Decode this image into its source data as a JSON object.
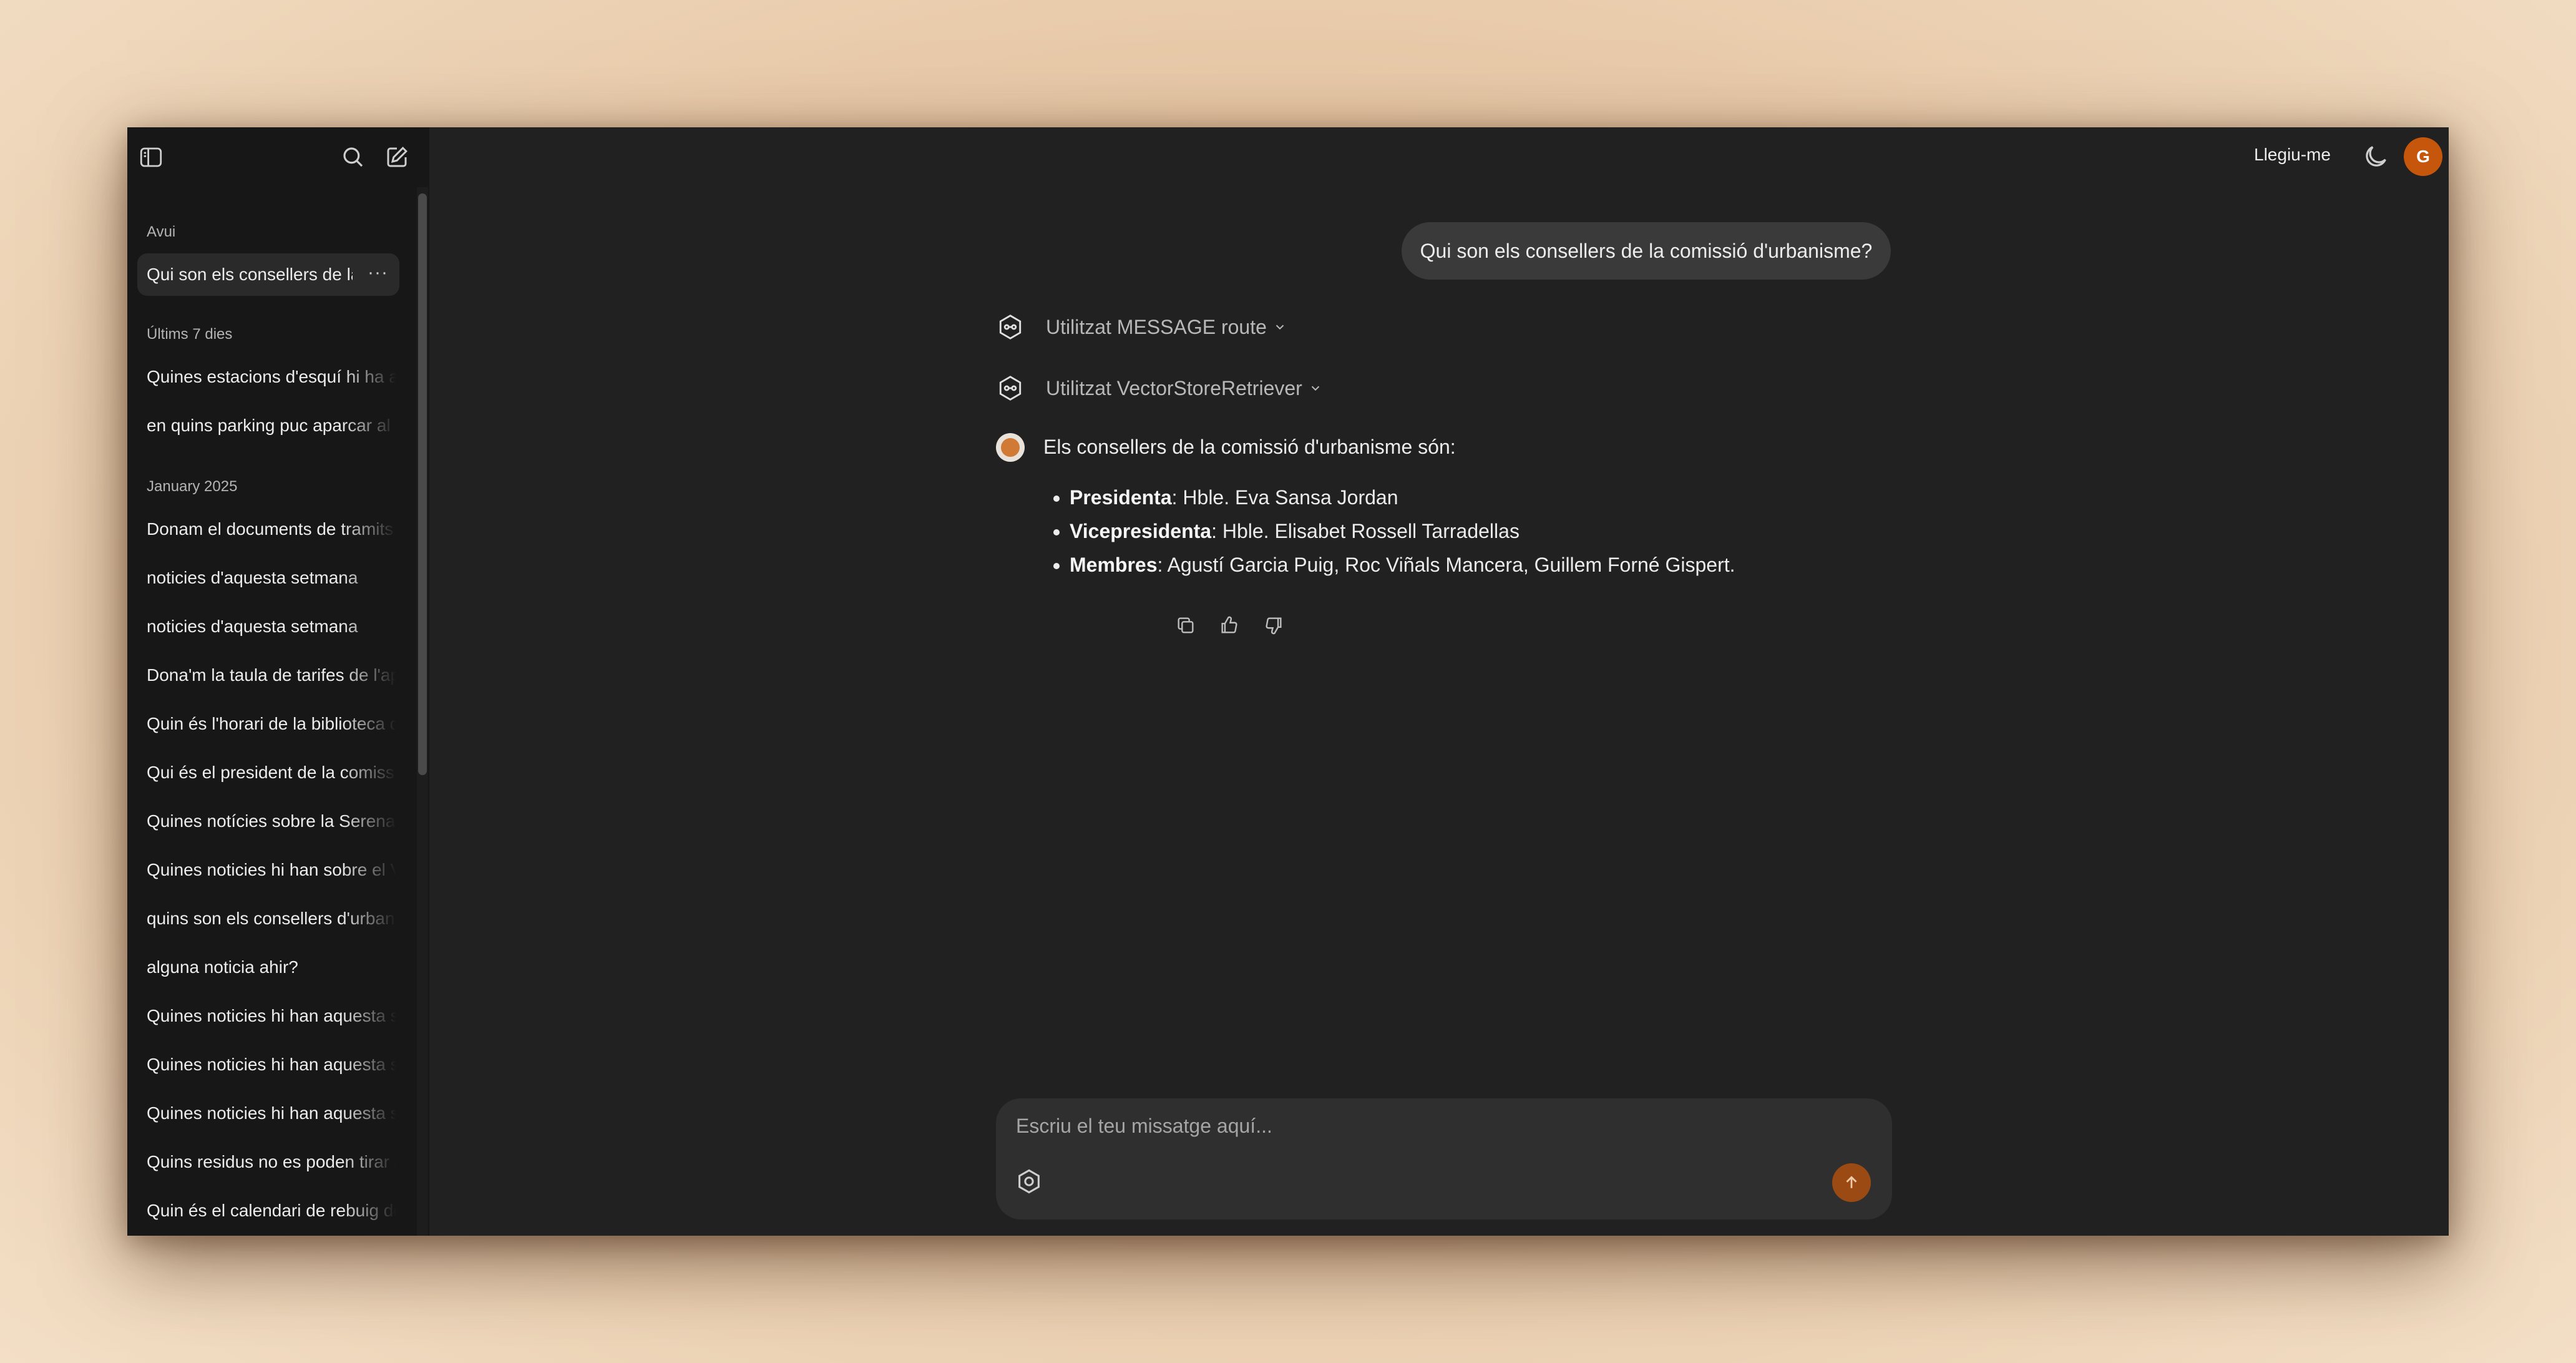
{
  "sidebar": {
    "sections": [
      {
        "label": "Avui"
      },
      {
        "label": "Últims 7 dies"
      },
      {
        "label": "January 2025"
      }
    ],
    "active_chat": {
      "label": "Qui son els consellers de la comissió d'urbanisme?",
      "more": "···"
    },
    "chats_7days": [
      {
        "label": "Quines estacions d'esquí hi ha a Andorra?"
      },
      {
        "label": "en quins parking puc aparcar al centre?"
      }
    ],
    "chats_january": [
      {
        "label": "Donam el documents de tramits i gestions"
      },
      {
        "label": "noticies d'aquesta setmana"
      },
      {
        "label": "noticies d'aquesta setmana"
      },
      {
        "label": "Dona'm la taula de tarifes de l'aparcament"
      },
      {
        "label": "Quin és l'horari de la biblioteca de la Massana?"
      },
      {
        "label": "Qui és el president de la comissió d'urbanisme?"
      },
      {
        "label": "Quines notícies sobre la Serenata de Nadal?"
      },
      {
        "label": "Quines noticies hi han sobre el Vallnord?"
      },
      {
        "label": "quins son els consellers d'urbanisme?"
      },
      {
        "label": "alguna noticia ahir?"
      },
      {
        "label": "Quines noticies hi han aquesta setmana?"
      },
      {
        "label": "Quines noticies hi han aquesta setmana?"
      },
      {
        "label": "Quines noticies hi han aquesta setmana?"
      },
      {
        "label": "Quins residus no es poden tirar al contenidor?"
      },
      {
        "label": "Quin és el calendari de rebuig de residus?"
      }
    ]
  },
  "header": {
    "readme": "Llegiu-me",
    "avatar_initial": "G",
    "avatar_color": "#c7560d"
  },
  "conversation": {
    "user_message": "Qui son els consellers de la comissió d'urbanisme?",
    "tools": [
      {
        "label": "Utilitzat MESSAGE route",
        "icon": "langchain-hex-icon"
      },
      {
        "label": "Utilitzat VectorStoreRetriever",
        "icon": "langchain-hex-icon"
      }
    ],
    "answer": {
      "intro": "Els consellers de la comissió d'urbanisme són:",
      "items": [
        {
          "role": "Presidenta",
          "text": ": Hble. Eva Sansa Jordan"
        },
        {
          "role": "Vicepresidenta",
          "text": ": Hble. Elisabet Rossell Tarradellas"
        },
        {
          "role": "Membres",
          "text": ": Agustí Garcia Puig, Roc Viñals Mancera, Guillem Forné Gispert."
        }
      ]
    }
  },
  "composer": {
    "placeholder": "Escriu el teu missatge aquí...",
    "send_color": "#9a4a12"
  }
}
